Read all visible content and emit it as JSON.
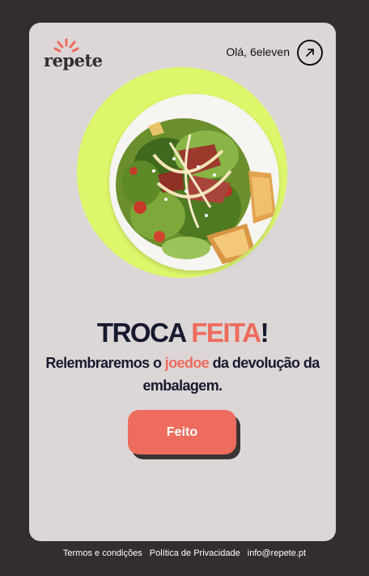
{
  "brand": {
    "logo_text": "repete",
    "accent_color": "#ee6c5d",
    "highlight_color": "#dcf76a",
    "dark_color": "#17192e"
  },
  "header": {
    "greeting": "Olá, 6eleven",
    "action_icon": "arrow-up-right-icon"
  },
  "hero": {
    "image": "caesar-salad-plate"
  },
  "message": {
    "title_part1": "TROCA",
    "title_part2": "FEITA",
    "title_part3": "!",
    "subtitle_part1": "Relembraremos o",
    "subtitle_highlight": "joedoe",
    "subtitle_part2": "da devolução da embalagem."
  },
  "actions": {
    "done_label": "Feito"
  },
  "footer": {
    "terms": "Termos e condições",
    "privacy": "Política de Privacidade",
    "email": "info@repete.pt"
  }
}
